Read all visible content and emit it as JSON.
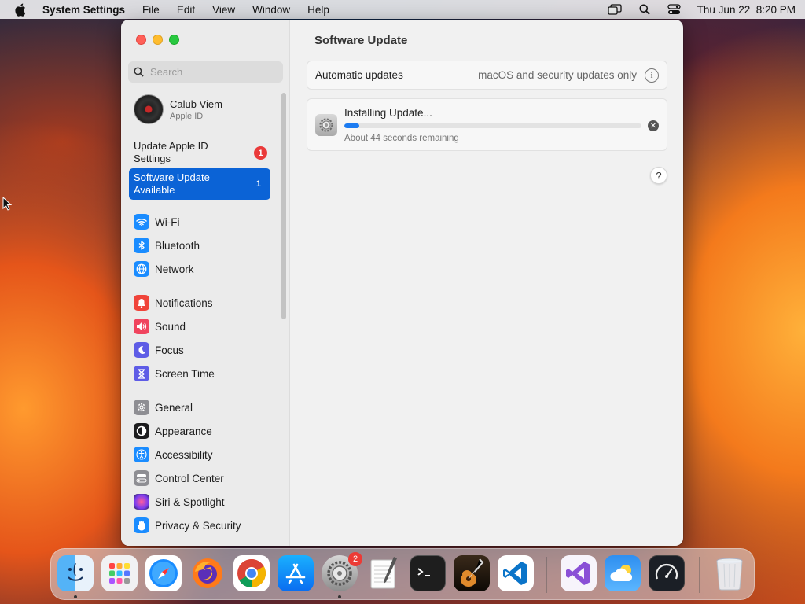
{
  "menubar": {
    "app_name": "System Settings",
    "menus": [
      "File",
      "Edit",
      "View",
      "Window",
      "Help"
    ],
    "datetime": "Thu Jun 22  8:20 PM"
  },
  "sidebar": {
    "search_placeholder": "Search",
    "account": {
      "name": "Calub Viem",
      "subtitle": "Apple ID"
    },
    "apple_id_alert": {
      "label": "Update Apple ID Settings",
      "badge": "1"
    },
    "selected": {
      "label": "Software Update Available",
      "count": "1"
    },
    "groups": [
      [
        {
          "label": "Wi-Fi",
          "icon": "wifi-icon",
          "color": "#1a8cff"
        },
        {
          "label": "Bluetooth",
          "icon": "bluetooth-icon",
          "color": "#1a8cff"
        },
        {
          "label": "Network",
          "icon": "globe-icon",
          "color": "#1a8cff"
        }
      ],
      [
        {
          "label": "Notifications",
          "icon": "bell-icon",
          "color": "#f0443a"
        },
        {
          "label": "Sound",
          "icon": "speaker-icon",
          "color": "#f0445e"
        },
        {
          "label": "Focus",
          "icon": "moon-icon",
          "color": "#5e5ce6"
        },
        {
          "label": "Screen Time",
          "icon": "hourglass-icon",
          "color": "#5e5ce6"
        }
      ],
      [
        {
          "label": "General",
          "icon": "gear-icon",
          "color": "#8e8e93"
        },
        {
          "label": "Appearance",
          "icon": "appearance-icon",
          "color": "#1c1c1e"
        },
        {
          "label": "Accessibility",
          "icon": "accessibility-icon",
          "color": "#1a8cff"
        },
        {
          "label": "Control Center",
          "icon": "control-center-icon",
          "color": "#8e8e93"
        },
        {
          "label": "Siri & Spotlight",
          "icon": "siri-icon",
          "color": "#b03cd6"
        },
        {
          "label": "Privacy & Security",
          "icon": "hand-icon",
          "color": "#1a8cff"
        }
      ]
    ]
  },
  "main": {
    "title": "Software Update",
    "automatic_updates": {
      "label": "Automatic updates",
      "value": "macOS and security updates only"
    },
    "install": {
      "title": "Installing Update...",
      "progress": 0.05,
      "remaining": "About 44 seconds remaining"
    },
    "help_label": "?"
  },
  "dock": {
    "apps": [
      "Finder",
      "Launchpad",
      "Safari",
      "Firefox",
      "Chrome",
      "App Store",
      "System Settings",
      "TextEdit",
      "Terminal",
      "GarageBand",
      "Visual Studio Code",
      "Visual Studio",
      "Weather",
      "Activity Monitor",
      "Trash"
    ],
    "system_settings_badge": "2"
  }
}
